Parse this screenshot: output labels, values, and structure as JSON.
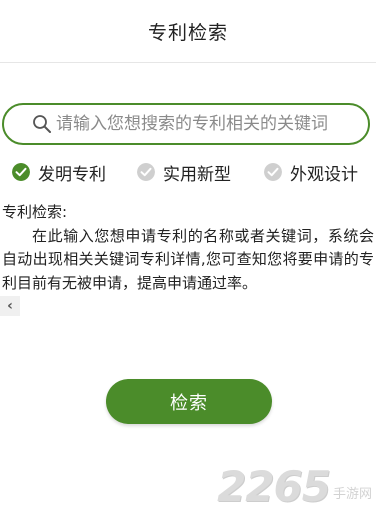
{
  "header": {
    "title": "专利检索"
  },
  "search": {
    "placeholder": "请输入您想搜索的专利相关的关键词"
  },
  "patent_types": [
    {
      "label": "发明专利",
      "selected": true
    },
    {
      "label": "实用新型",
      "selected": false
    },
    {
      "label": "外观设计",
      "selected": false
    }
  ],
  "description": {
    "title": "专利检索:",
    "body": "在此输入您想申请专利的名称或者关键词，系统会自动出现相关关键词专利详情,您可查知您将要申请的专利目前有无被申请，提高申请通过率。"
  },
  "actions": {
    "search_label": "检索"
  },
  "watermark": {
    "logo": "2265",
    "site": "手游网"
  },
  "colors": {
    "accent": "#4b8c2a",
    "unchecked": "#cfcfcf",
    "divider": "#e6e6e6"
  },
  "icons": {
    "search": "search-icon",
    "back": "chevron-left-icon",
    "checked": "check-circle-icon"
  }
}
